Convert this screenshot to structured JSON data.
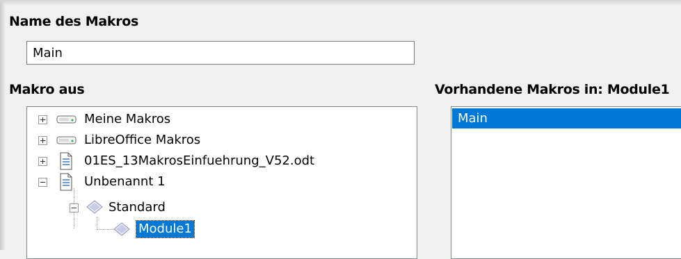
{
  "dialog": {
    "name_heading": "Name des Makros",
    "macro_name_value": "Main",
    "macro_from_heading": "Makro aus",
    "existing_macros_heading": "Vorhandene Makros in: Module1"
  },
  "tree": {
    "items": [
      {
        "label": "Meine Makros",
        "icon": "drive-icon",
        "state": "collapsed"
      },
      {
        "label": "LibreOffice Makros",
        "icon": "drive-icon",
        "state": "collapsed"
      },
      {
        "label": "01ES_13MakrosEinfuehrung_V52.odt",
        "icon": "document-icon",
        "state": "collapsed"
      },
      {
        "label": "Unbenannt 1",
        "icon": "document-icon",
        "state": "expanded"
      },
      {
        "label": "Standard",
        "icon": "library-icon",
        "state": "expanded"
      },
      {
        "label": "Module1",
        "icon": "module-icon",
        "state": "selected"
      }
    ]
  },
  "existing_macros": {
    "items": [
      "Main"
    ],
    "selected": "Main"
  },
  "colors": {
    "selection": "#0078d7",
    "window_bg": "#f0f0f0"
  }
}
